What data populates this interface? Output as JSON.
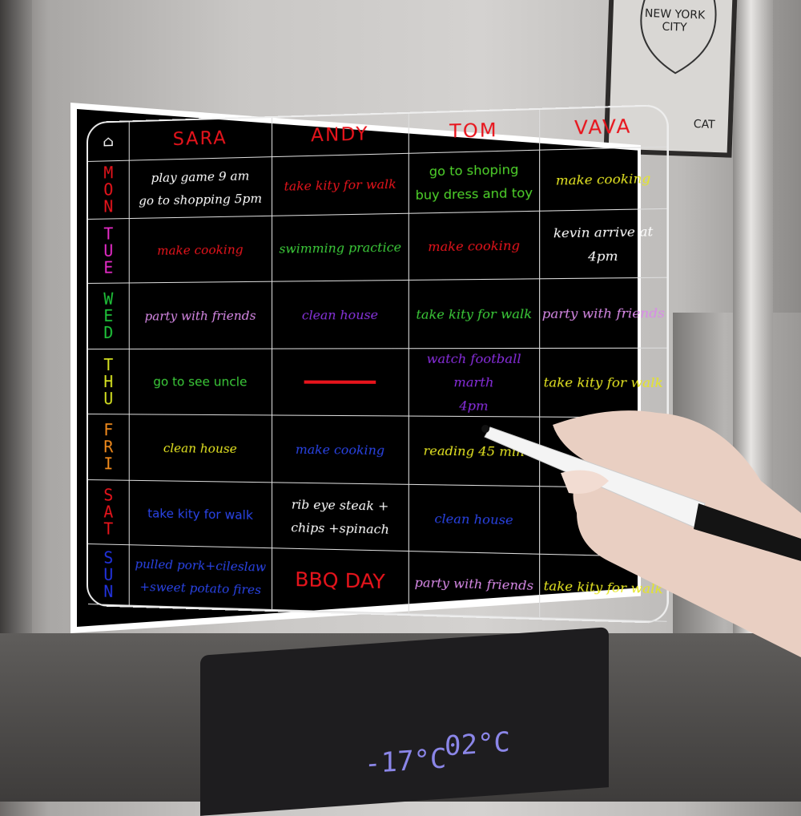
{
  "background": {
    "frame_text": "NEW YORK CITY",
    "frame_signature": "CAT",
    "freezer_temp": "-17°C",
    "fridge_temp": "02°C"
  },
  "board": {
    "corner_icon": "house-icon",
    "people": [
      "SARA",
      "ANDY",
      "TOM",
      "VAVA"
    ],
    "days": [
      {
        "label": "MON",
        "color": "#e8141c"
      },
      {
        "label": "TUE",
        "color": "#e62bc8"
      },
      {
        "label": "WED",
        "color": "#1fc43a"
      },
      {
        "label": "THU",
        "color": "#d4e021"
      },
      {
        "label": "FRI",
        "color": "#f08a1c"
      },
      {
        "label": "SAT",
        "color": "#e8141c"
      },
      {
        "label": "SUN",
        "color": "#2233e0"
      }
    ],
    "cells": [
      [
        {
          "lines": [
            "play game 9 am",
            "go to shopping 5pm"
          ],
          "color": "#ffffff"
        },
        {
          "lines": [
            "take kity for walk"
          ],
          "color": "#e8141c"
        },
        {
          "lines": [
            "go to shoping",
            "buy dress and toy"
          ],
          "color": "#4fd42b",
          "print": true
        },
        {
          "lines": [
            "make cooking"
          ],
          "color": "#e6e622"
        }
      ],
      [
        {
          "lines": [
            "make cooking"
          ],
          "color": "#e8141c"
        },
        {
          "lines": [
            "swimming practice"
          ],
          "color": "#3ccc3a"
        },
        {
          "lines": [
            "make cooking"
          ],
          "color": "#e8141c"
        },
        {
          "lines": [
            "kevin arrive at",
            "4pm"
          ],
          "color": "#ffffff"
        }
      ],
      [
        {
          "lines": [
            "party with friends"
          ],
          "color": "#d98ae8"
        },
        {
          "lines": [
            "clean house"
          ],
          "color": "#8a34e0"
        },
        {
          "lines": [
            "take kity for walk"
          ],
          "color": "#3ccc3a"
        },
        {
          "lines": [
            "party with friends"
          ],
          "color": "#d98ae8"
        }
      ],
      [
        {
          "lines": [
            "go to see uncle"
          ],
          "color": "#3ccc3a",
          "print": true
        },
        {
          "lines": [],
          "color": "#e8141c",
          "dash": true
        },
        {
          "lines": [
            "watch football marth",
            "4pm"
          ],
          "color": "#8a2ee0"
        },
        {
          "lines": [
            "take kity for walk"
          ],
          "color": "#e6e622"
        }
      ],
      [
        {
          "lines": [
            "clean house"
          ],
          "color": "#e6e622"
        },
        {
          "lines": [
            "make cooking"
          ],
          "color": "#2a44e8"
        },
        {
          "lines": [
            "reading 45 min"
          ],
          "color": "#e6e622"
        },
        {
          "lines": [],
          "color": "#3ccc3a"
        }
      ],
      [
        {
          "lines": [
            "take kity for walk"
          ],
          "color": "#2a44e8",
          "print": true
        },
        {
          "lines": [
            "rib eye steak +",
            "chips +spinach"
          ],
          "color": "#ffffff"
        },
        {
          "lines": [
            "clean house"
          ],
          "color": "#2a44e8"
        },
        {
          "lines": [],
          "color": "#ffffff"
        }
      ],
      [
        {
          "lines": [
            "pulled pork+cileslaw",
            "+sweet potato fires"
          ],
          "color": "#2a44e8"
        },
        {
          "lines": [
            "BBQ DAY"
          ],
          "color": "#e8141c",
          "print": true,
          "big": true
        },
        {
          "lines": [
            "party with friends"
          ],
          "color": "#d98ae8"
        },
        {
          "lines": [
            "take kity for walk"
          ],
          "color": "#e6e622"
        }
      ]
    ]
  }
}
